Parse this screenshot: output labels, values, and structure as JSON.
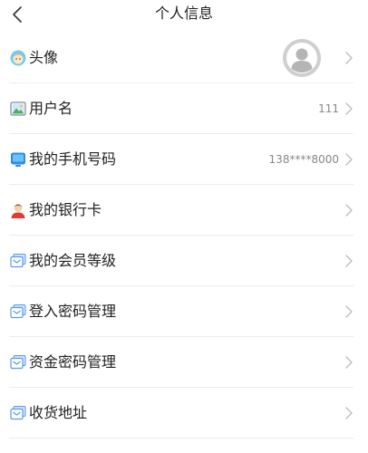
{
  "header": {
    "title": "个人信息",
    "back_icon": "chevron-left-icon"
  },
  "items": [
    {
      "label": "头像",
      "value": "",
      "icon": "avatar-face-icon",
      "has_avatar": true
    },
    {
      "label": "用户名",
      "value": "111",
      "icon": "photo-icon"
    },
    {
      "label": "我的手机号码",
      "value": "138****8000",
      "icon": "monitor-icon"
    },
    {
      "label": "我的银行卡",
      "value": "",
      "icon": "person-icon"
    },
    {
      "label": "我的会员等级",
      "value": "",
      "icon": "message-card-icon"
    },
    {
      "label": "登入密码管理",
      "value": "",
      "icon": "message-card-icon"
    },
    {
      "label": "资金密码管理",
      "value": "",
      "icon": "message-card-icon"
    },
    {
      "label": "收货地址",
      "value": "",
      "icon": "message-card-icon"
    }
  ],
  "colors": {
    "text": "#222222",
    "value": "#888888",
    "chevron": "#bbbbbb",
    "divider": "#ececec"
  }
}
